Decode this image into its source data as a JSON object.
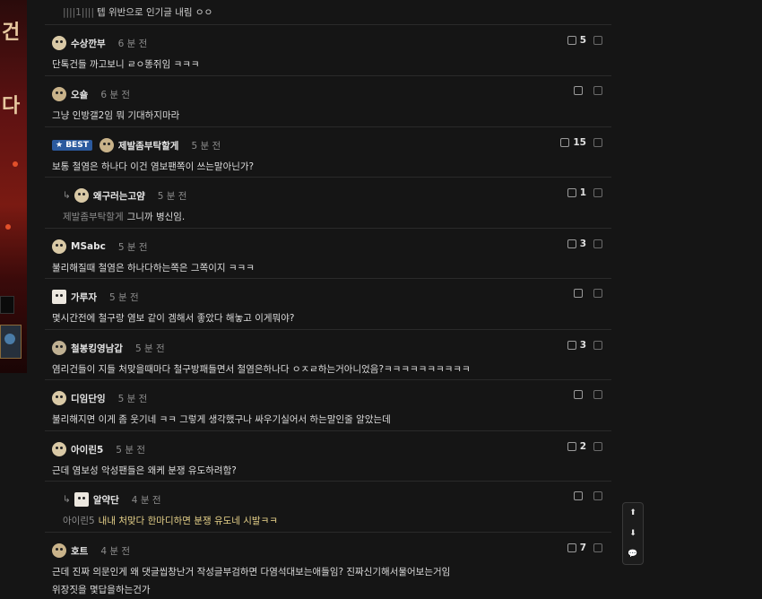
{
  "top_partial": {
    "text": "텝 위반으로 인기글 내림 ㅇㅇ",
    "prefix": "||||1||||"
  },
  "comments": [
    {
      "nick": "수상깐부",
      "time": "6 분 전",
      "text": "단톡건들 까고보니 ㄹㅇ똥쥐임 ㅋㅋㅋ",
      "up": "5",
      "best": false,
      "reply": false
    },
    {
      "nick": "오숄",
      "time": "6 분 전",
      "text": "그냥 인방갤2임 뭐 기대하지마라",
      "up": "",
      "best": false,
      "reply": false
    },
    {
      "nick": "제발좀부탁할게",
      "time": "5 분 전",
      "text": "보통 철염은 하나다 이건 염보팬쪽이 쓰는말아닌가?",
      "up": "15",
      "best": true,
      "best_label": "★ BEST",
      "reply": false
    },
    {
      "nick": "왜구러는고얌",
      "time": "5 분 전",
      "ref": "제발좀부탁할게",
      "text": "그니까 병신임.",
      "up": "1",
      "best": false,
      "reply": true
    },
    {
      "nick": "MSabc",
      "time": "5 분 전",
      "text": "불리해질때 철염은 하나다하는쪽은 그쪽이지 ㅋㅋㅋ",
      "up": "3",
      "best": false,
      "reply": false
    },
    {
      "nick": "가루자",
      "time": "5 분 전",
      "text": "몇시간전에 철구랑 염보 같이 겜해서 좋았다 해놓고 이게뭐야?",
      "up": "",
      "best": false,
      "reply": false
    },
    {
      "nick": "철봉킹영남갑",
      "time": "5 분 전",
      "text": "염리건들이 지들 처맞을때마다 철구방패들면서 철염은하나다 ㅇㅈㄹ하는거아니었음?ㅋㅋㅋㅋㅋㅋㅋㅋㅋㅋ",
      "up": "3",
      "best": false,
      "reply": false
    },
    {
      "nick": "디임단잉",
      "time": "5 분 전",
      "text": "불리해지면 이게 좀 웃기네 ㅋㅋ 그렇게 생각했구나 싸우기실어서 하는말인줄 알았는데",
      "up": "",
      "best": false,
      "reply": false
    },
    {
      "nick": "아이린5",
      "time": "5 분 전",
      "text": "근데 염보성 악성팬들은 왜케 분쟁 유도하려함?",
      "up": "2",
      "best": false,
      "reply": false
    },
    {
      "nick": "알약단",
      "time": "4 분 전",
      "ref": "아이린5",
      "text": "내내 처맞다 한마디하면 분쟁 유도네 시발ㅋㅋ",
      "up": "",
      "best": false,
      "reply": true,
      "gold": true
    },
    {
      "nick": "호트",
      "time": "4 분 전",
      "text": "근데 진짜 의문인게 왜 댓글씹창난거 작성글부검하면 다염석대보는애들임? 진짜신기해서물어보는거임",
      "text2": "위장짓을 몇답을하는건가",
      "up": "7",
      "best": false,
      "reply": false
    }
  ],
  "float_nav": {
    "up": "⬆",
    "down": "⬇",
    "comment": "💬"
  },
  "colors": {
    "background": "#151515",
    "best_badge": "#2b5a9e",
    "gold_text": "#e7d28a"
  }
}
